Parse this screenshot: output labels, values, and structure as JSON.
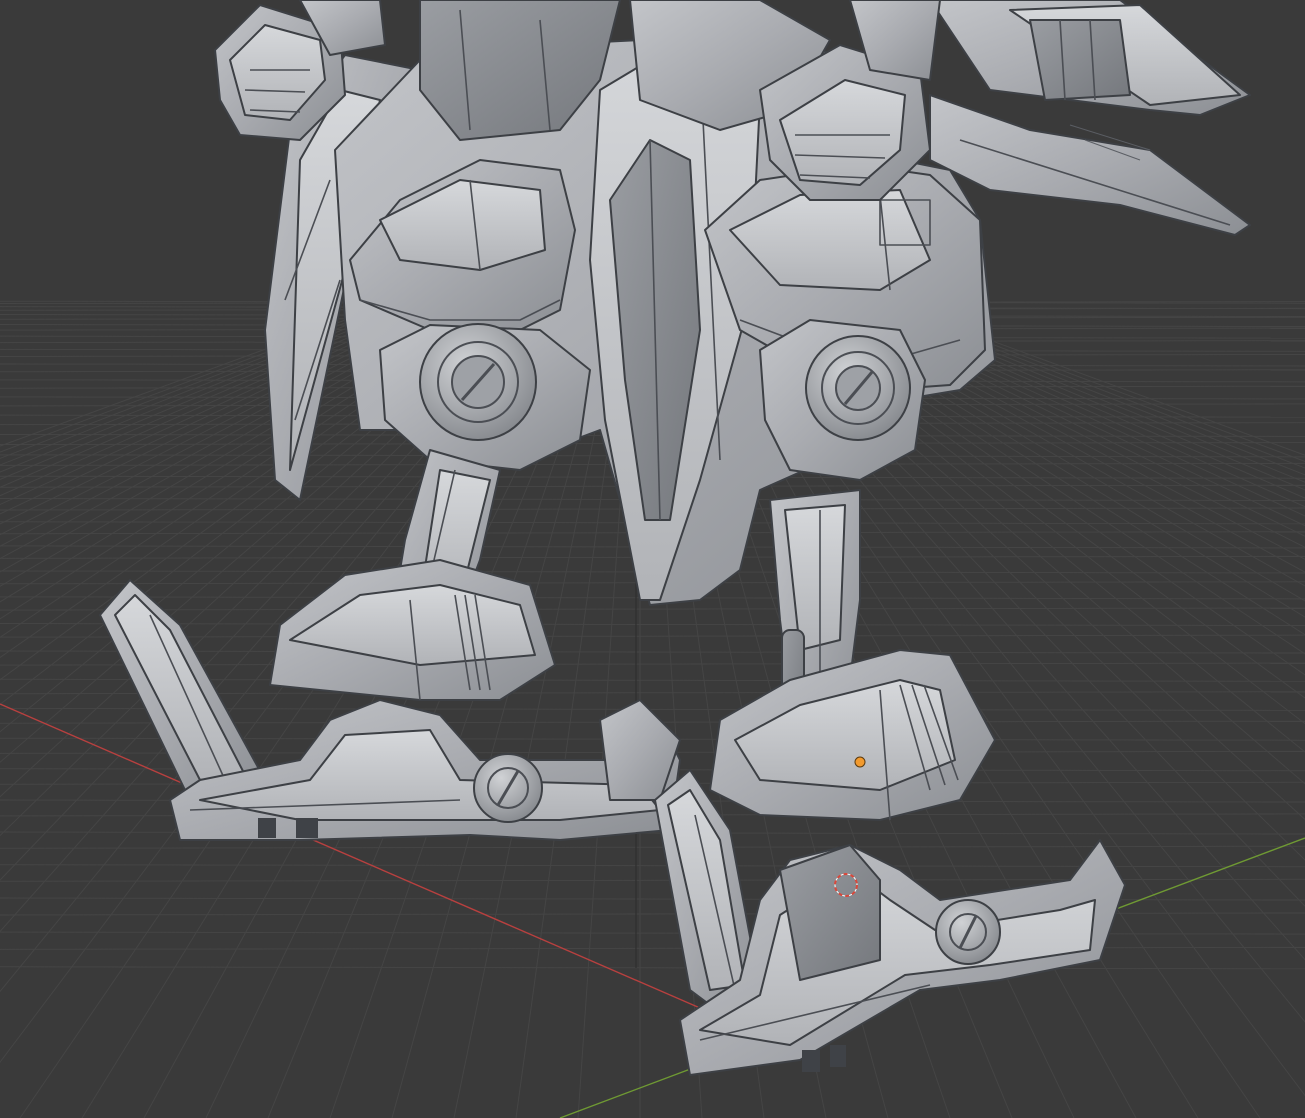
{
  "viewport": {
    "background": "#3a3a3a",
    "grid_color": "#454545",
    "axis_x_color": "#c24a4a",
    "axis_y_color": "#7aa33a",
    "mesh_color": "#a7a9ad",
    "selection_color": "#f29a2e",
    "cursor_color": "#d9483b"
  },
  "overlay": {
    "grid_icon": "floor-grid",
    "axis_x_label": "",
    "axis_y_label": "",
    "cursor_icon": "3d-cursor-icon",
    "origin_icon": "object-origin-icon"
  },
  "model": {
    "parts": [
      "left-wing-fin",
      "torso-skirt",
      "left-hand",
      "right-hand",
      "right-shoulder-cannon",
      "left-knee-joint",
      "right-knee-joint",
      "left-shin",
      "right-shin",
      "left-foot",
      "right-foot",
      "left-foot-fin",
      "right-foot-fin"
    ]
  }
}
